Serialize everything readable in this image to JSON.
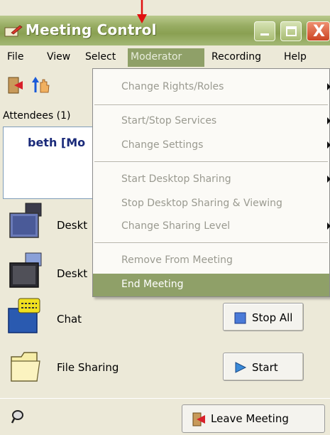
{
  "window": {
    "title": "Meeting Control",
    "accent": "#8fa068",
    "title_icon": "edit-pencil-icon",
    "buttons": [
      "minimize-icon",
      "maximize-icon",
      "close-icon"
    ],
    "close_glyph": "X"
  },
  "annotation": {
    "pointer": "red-arrow-icon"
  },
  "menubar": {
    "items": [
      {
        "label": "File"
      },
      {
        "label": "View"
      },
      {
        "label": "Select"
      },
      {
        "label": "Moderator",
        "active": true
      },
      {
        "label": "Recording"
      },
      {
        "label": "Help"
      }
    ]
  },
  "toolbar": {
    "icons": [
      "exit-door-icon",
      "raise-hand-icon"
    ]
  },
  "attendees": {
    "header": "Attendees (1)",
    "list": [
      {
        "name": "beth [Mo"
      }
    ]
  },
  "services": [
    {
      "label": "Deskt",
      "icon": "desktop-sharing-icon"
    },
    {
      "label": "Deskt",
      "icon": "desktop-viewing-icon"
    },
    {
      "label": "Chat",
      "icon": "chat-icon",
      "button": "Stop All",
      "button_icon": "stop-square-icon"
    },
    {
      "label": "File Sharing",
      "icon": "folder-icon",
      "button": "Start",
      "button_icon": "play-arrow-icon"
    }
  ],
  "footer": {
    "status_icon": "connection-icon",
    "leave_label": "Leave Meeting",
    "leave_icon": "exit-door-icon"
  },
  "dropdown": {
    "menu": "Moderator",
    "items": [
      {
        "label": "Change Rights/Roles",
        "submenu": true,
        "enabled": false
      },
      {
        "label": "Start/Stop Services",
        "submenu": true,
        "enabled": false
      },
      {
        "label": "Change Settings",
        "submenu": true,
        "enabled": false
      },
      {
        "label": "Start Desktop Sharing",
        "submenu": true,
        "enabled": false
      },
      {
        "label": "Stop Desktop Sharing & Viewing",
        "submenu": false,
        "enabled": false
      },
      {
        "label": "Change Sharing Level",
        "submenu": true,
        "enabled": false
      },
      {
        "label": "Remove From Meeting",
        "submenu": false,
        "enabled": false
      },
      {
        "label": "End Meeting",
        "submenu": false,
        "enabled": true,
        "highlighted": true
      }
    ]
  }
}
